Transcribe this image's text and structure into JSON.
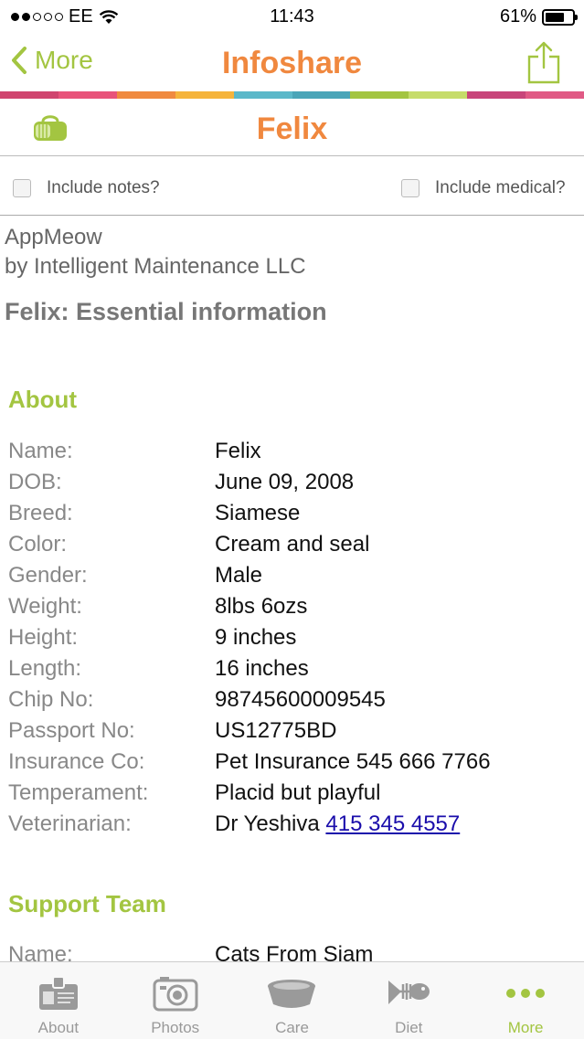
{
  "status": {
    "carrier": "EE",
    "time": "11:43",
    "battery": "61%"
  },
  "nav": {
    "back_label": "More",
    "title": "Infoshare"
  },
  "pet": {
    "name": "Felix"
  },
  "options": {
    "notes_label": "Include notes?",
    "medical_label": "Include medical?"
  },
  "header": {
    "app_name": "AppMeow",
    "publisher": "by Intelligent Maintenance LLC",
    "essential_title": "Felix: Essential information"
  },
  "about": {
    "title": "About",
    "rows": [
      {
        "label": "Name:",
        "value": "Felix"
      },
      {
        "label": "DOB:",
        "value": "June 09, 2008"
      },
      {
        "label": "Breed:",
        "value": "Siamese"
      },
      {
        "label": "Color:",
        "value": "Cream and seal"
      },
      {
        "label": "Gender:",
        "value": "Male"
      },
      {
        "label": "Weight:",
        "value": "8lbs 6ozs"
      },
      {
        "label": "Height:",
        "value": "9 inches"
      },
      {
        "label": "Length:",
        "value": "16 inches"
      },
      {
        "label": "Chip No:",
        "value": "98745600009545"
      },
      {
        "label": "Passport No:",
        "value": "US12775BD"
      },
      {
        "label": "Insurance Co:",
        "value": "Pet Insurance 545 666 7766"
      },
      {
        "label": "Temperament:",
        "value": "Placid but playful"
      },
      {
        "label": "Veterinarian:",
        "value": "Dr Yeshiva",
        "phone": "415 345 4557"
      }
    ]
  },
  "support": {
    "title": "Support Team",
    "rows": [
      {
        "label": "Name:",
        "value": "Cats From Siam"
      }
    ]
  },
  "tabs": [
    {
      "label": "About",
      "icon": "id-badge-icon"
    },
    {
      "label": "Photos",
      "icon": "camera-icon"
    },
    {
      "label": "Care",
      "icon": "bowl-icon"
    },
    {
      "label": "Diet",
      "icon": "fishbone-icon"
    },
    {
      "label": "More",
      "icon": "more-dots-icon"
    }
  ],
  "colors": {
    "accent_green": "#a3c541",
    "accent_orange": "#f0883f",
    "stripe": [
      "#d0456f",
      "#e8537a",
      "#f08a3f",
      "#f5b43b",
      "#5bb8c9",
      "#4aa5b8",
      "#a3c541",
      "#c6dc6a",
      "#c8457a",
      "#e05a85"
    ]
  }
}
